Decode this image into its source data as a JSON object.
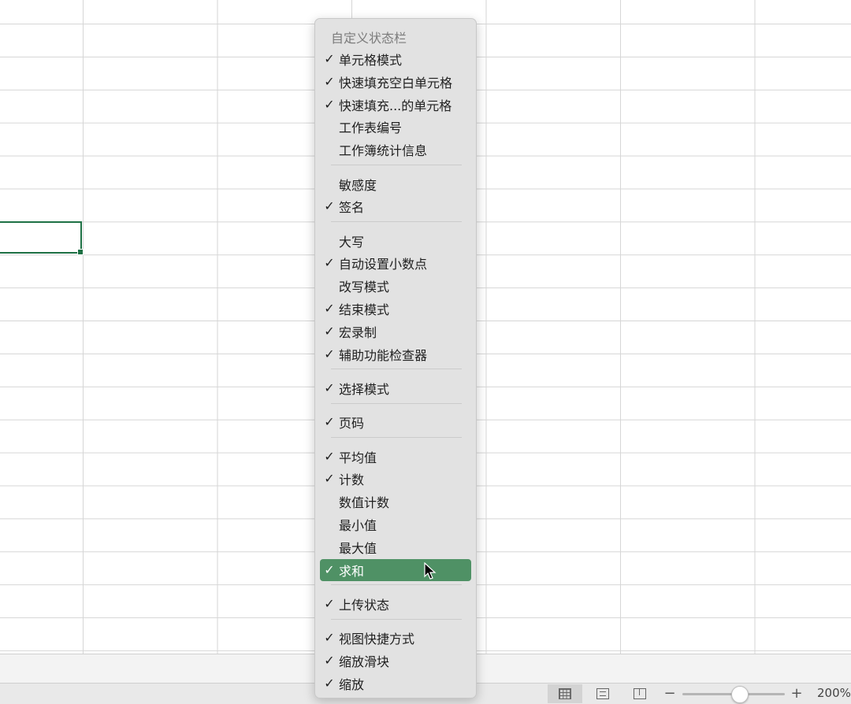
{
  "menu": {
    "title": "自定义状态栏",
    "groups": [
      {
        "items": [
          {
            "label": "单元格模式",
            "checked": true
          },
          {
            "label": "快速填充空白单元格",
            "checked": true
          },
          {
            "label": "快速填充...的单元格",
            "checked": true
          },
          {
            "label": "工作表编号",
            "checked": false
          },
          {
            "label": "工作簿统计信息",
            "checked": false
          }
        ]
      },
      {
        "items": [
          {
            "label": "敏感度",
            "checked": false
          },
          {
            "label": "签名",
            "checked": true
          }
        ]
      },
      {
        "items": [
          {
            "label": "大写",
            "checked": false
          },
          {
            "label": "自动设置小数点",
            "checked": true
          },
          {
            "label": "改写模式",
            "checked": false
          },
          {
            "label": "结束模式",
            "checked": true
          },
          {
            "label": "宏录制",
            "checked": true
          },
          {
            "label": "辅助功能检查器",
            "checked": true
          }
        ]
      },
      {
        "items": [
          {
            "label": "选择模式",
            "checked": true
          }
        ]
      },
      {
        "items": [
          {
            "label": "页码",
            "checked": true
          }
        ]
      },
      {
        "items": [
          {
            "label": "平均值",
            "checked": true
          },
          {
            "label": "计数",
            "checked": true
          },
          {
            "label": "数值计数",
            "checked": false
          },
          {
            "label": "最小值",
            "checked": false
          },
          {
            "label": "最大值",
            "checked": false
          },
          {
            "label": "求和",
            "checked": true,
            "highlighted": true
          }
        ]
      },
      {
        "items": [
          {
            "label": "上传状态",
            "checked": true
          }
        ]
      },
      {
        "items": [
          {
            "label": "视图快捷方式",
            "checked": true
          },
          {
            "label": "缩放滑块",
            "checked": true
          },
          {
            "label": "缩放",
            "checked": true
          }
        ]
      }
    ],
    "check_glyph": "✓",
    "highlight_color": "#4f9165"
  },
  "status_bar": {
    "zoom_minus": "−",
    "zoom_plus": "+",
    "zoom_level": "200%",
    "zoom_fraction": 0.55
  },
  "icons": {
    "normal_view": "grid-icon",
    "page_layout_view": "page-layout-icon",
    "page_break_view": "page-break-icon"
  },
  "colors": {
    "selection_border": "#1e7145"
  }
}
